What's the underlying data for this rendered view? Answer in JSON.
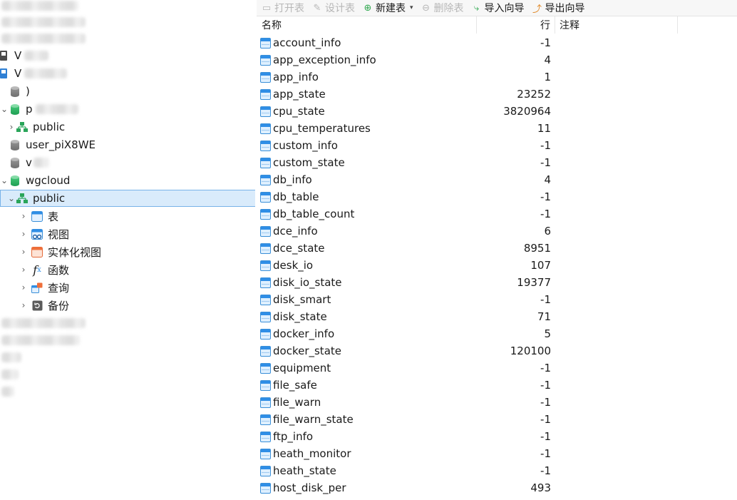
{
  "toolbar": {
    "open_table": "打开表",
    "design_table": "设计表",
    "new_table": "新建表",
    "delete_table": "删除表",
    "import_wizard": "导入向导",
    "export_wizard": "导出向导"
  },
  "tree": {
    "nodes": [
      {
        "label": "",
        "type": "blurred"
      },
      {
        "label": "",
        "type": "blurred"
      },
      {
        "label": "",
        "type": "blurred"
      },
      {
        "label": "V",
        "type": "conn"
      },
      {
        "label": "V",
        "type": "conn"
      },
      {
        "label": ")",
        "type": "db-gray"
      },
      {
        "label": "p",
        "type": "db-green"
      },
      {
        "label": "public",
        "type": "schema"
      },
      {
        "label": "user_piX8WE",
        "type": "db-gray"
      },
      {
        "label": "v",
        "type": "db-gray"
      },
      {
        "label": "wgcloud",
        "type": "db-green"
      },
      {
        "label": "public",
        "type": "schema"
      },
      {
        "label": "表",
        "type": "tables"
      },
      {
        "label": "视图",
        "type": "views"
      },
      {
        "label": "实体化视图",
        "type": "matviews"
      },
      {
        "label": "函数",
        "type": "functions"
      },
      {
        "label": "查询",
        "type": "queries"
      },
      {
        "label": "备份",
        "type": "backups"
      }
    ]
  },
  "grid": {
    "columns": [
      "名称",
      "行",
      "注释"
    ],
    "rows": [
      {
        "name": "account_info",
        "rows": "-1"
      },
      {
        "name": "app_exception_info",
        "rows": "4"
      },
      {
        "name": "app_info",
        "rows": "1"
      },
      {
        "name": "app_state",
        "rows": "23252"
      },
      {
        "name": "cpu_state",
        "rows": "3820964"
      },
      {
        "name": "cpu_temperatures",
        "rows": "11"
      },
      {
        "name": "custom_info",
        "rows": "-1"
      },
      {
        "name": "custom_state",
        "rows": "-1"
      },
      {
        "name": "db_info",
        "rows": "4"
      },
      {
        "name": "db_table",
        "rows": "-1"
      },
      {
        "name": "db_table_count",
        "rows": "-1"
      },
      {
        "name": "dce_info",
        "rows": "6"
      },
      {
        "name": "dce_state",
        "rows": "8951"
      },
      {
        "name": "desk_io",
        "rows": "107"
      },
      {
        "name": "disk_io_state",
        "rows": "19377"
      },
      {
        "name": "disk_smart",
        "rows": "-1"
      },
      {
        "name": "disk_state",
        "rows": "71"
      },
      {
        "name": "docker_info",
        "rows": "5"
      },
      {
        "name": "docker_state",
        "rows": "120100"
      },
      {
        "name": "equipment",
        "rows": "-1"
      },
      {
        "name": "file_safe",
        "rows": "-1"
      },
      {
        "name": "file_warn",
        "rows": "-1"
      },
      {
        "name": "file_warn_state",
        "rows": "-1"
      },
      {
        "name": "ftp_info",
        "rows": "-1"
      },
      {
        "name": "heath_monitor",
        "rows": "-1"
      },
      {
        "name": "heath_state",
        "rows": "-1"
      },
      {
        "name": "host_disk_per",
        "rows": "493"
      }
    ]
  }
}
